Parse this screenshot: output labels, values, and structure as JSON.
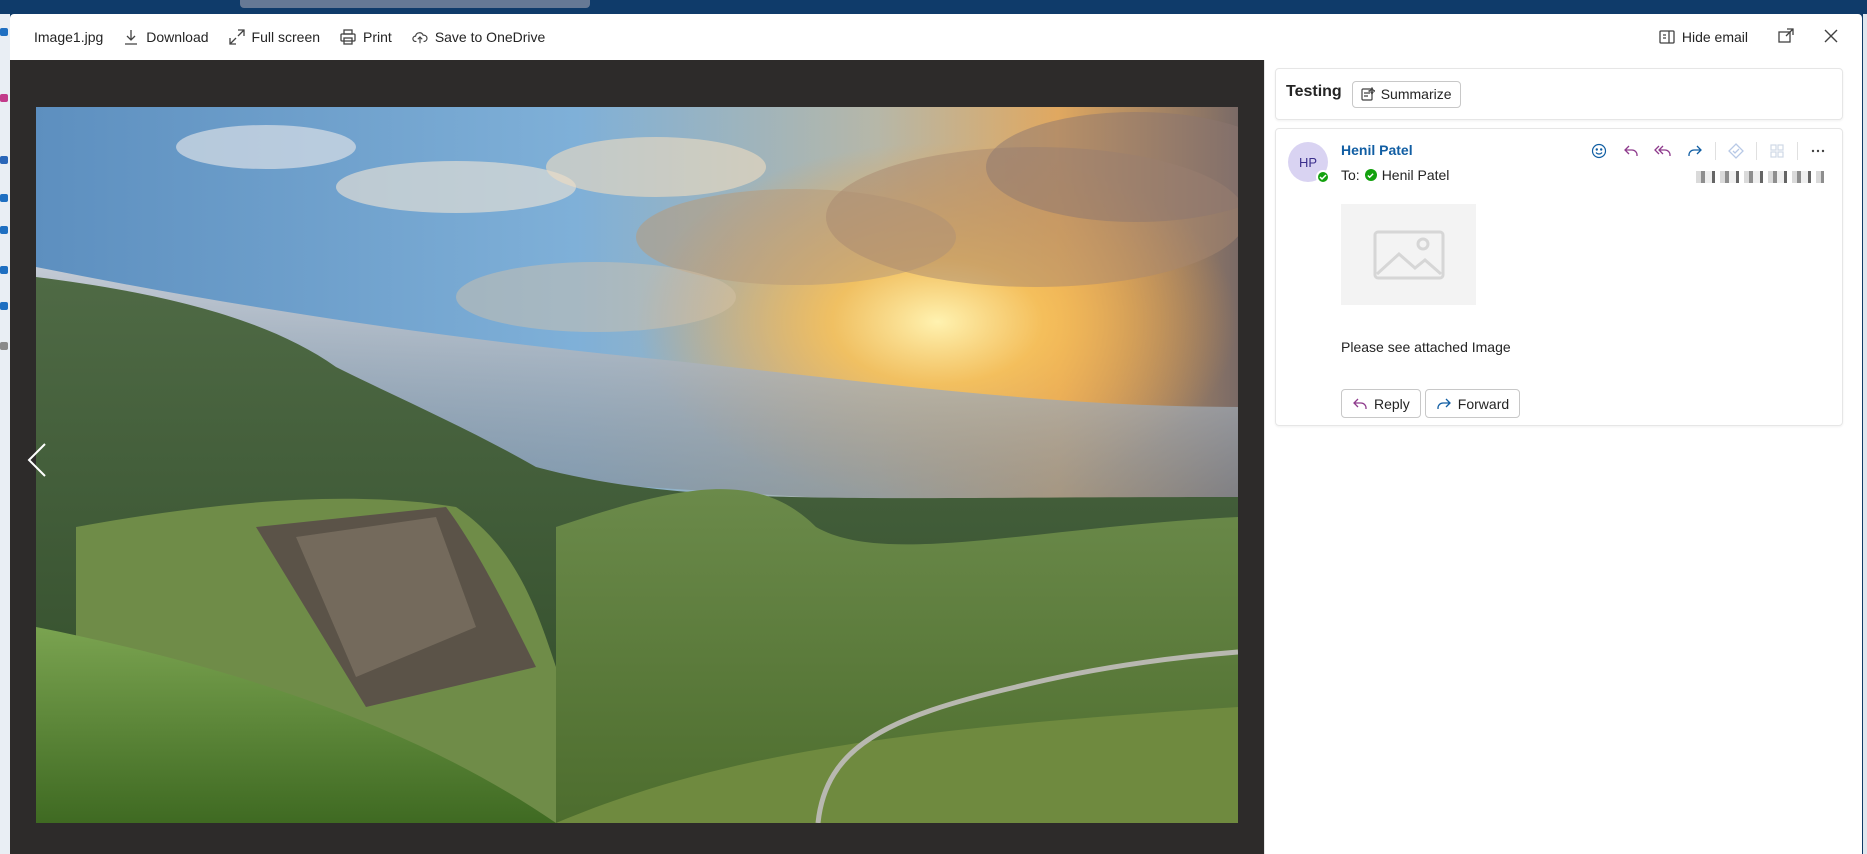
{
  "toolbar": {
    "file_name": "Image1.jpg",
    "download_label": "Download",
    "fullscreen_label": "Full screen",
    "print_label": "Print",
    "save_onedrive_label": "Save to OneDrive",
    "hide_email_label": "Hide email"
  },
  "viewer": {
    "image_description_icon": "landscape-photo"
  },
  "email": {
    "subject": "Testing",
    "summarize_label": "Summarize",
    "sender_initials": "HP",
    "sender_name": "Henil Patel",
    "to_prefix": "To:",
    "recipient_name": "Henil Patel",
    "body": "Please see attached Image",
    "reply_label": "Reply",
    "forward_label": "Forward"
  },
  "colors": {
    "accent": "#115ea3",
    "presence": "#13a10e",
    "viewer_bg": "#2d2b2a"
  }
}
